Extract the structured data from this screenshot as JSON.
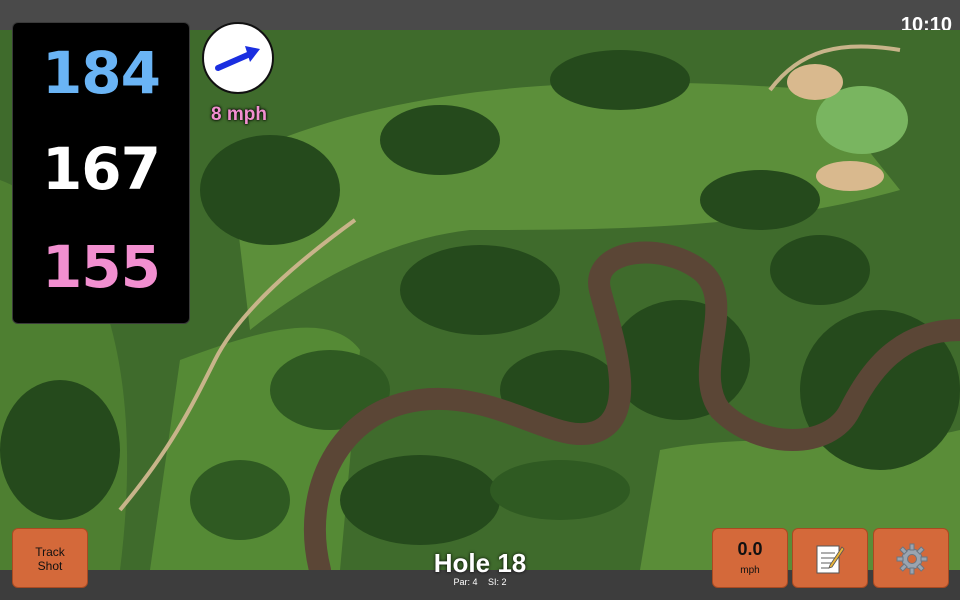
{
  "status": {
    "time": "10:10"
  },
  "yardages": {
    "back": {
      "value": "184",
      "color": "#6ab4f5"
    },
    "middle": {
      "value": "167",
      "color": "#ffffff"
    },
    "front": {
      "value": "155",
      "color": "#f28fd0"
    }
  },
  "wind": {
    "speed_label": "8 mph",
    "speed_color": "#f28fd0",
    "direction_icon": "arrow-icon",
    "arrow_color": "#1a2ee0"
  },
  "buttons": {
    "track_shot": "Track\nShot",
    "wind_value": "0.0",
    "wind_unit": "mph",
    "notes_icon": "notes-icon",
    "settings_icon": "gear-icon",
    "accent": "#d4693a"
  },
  "hole": {
    "title": "Hole 18",
    "par": "Par: 4",
    "si": "SI: 2"
  }
}
